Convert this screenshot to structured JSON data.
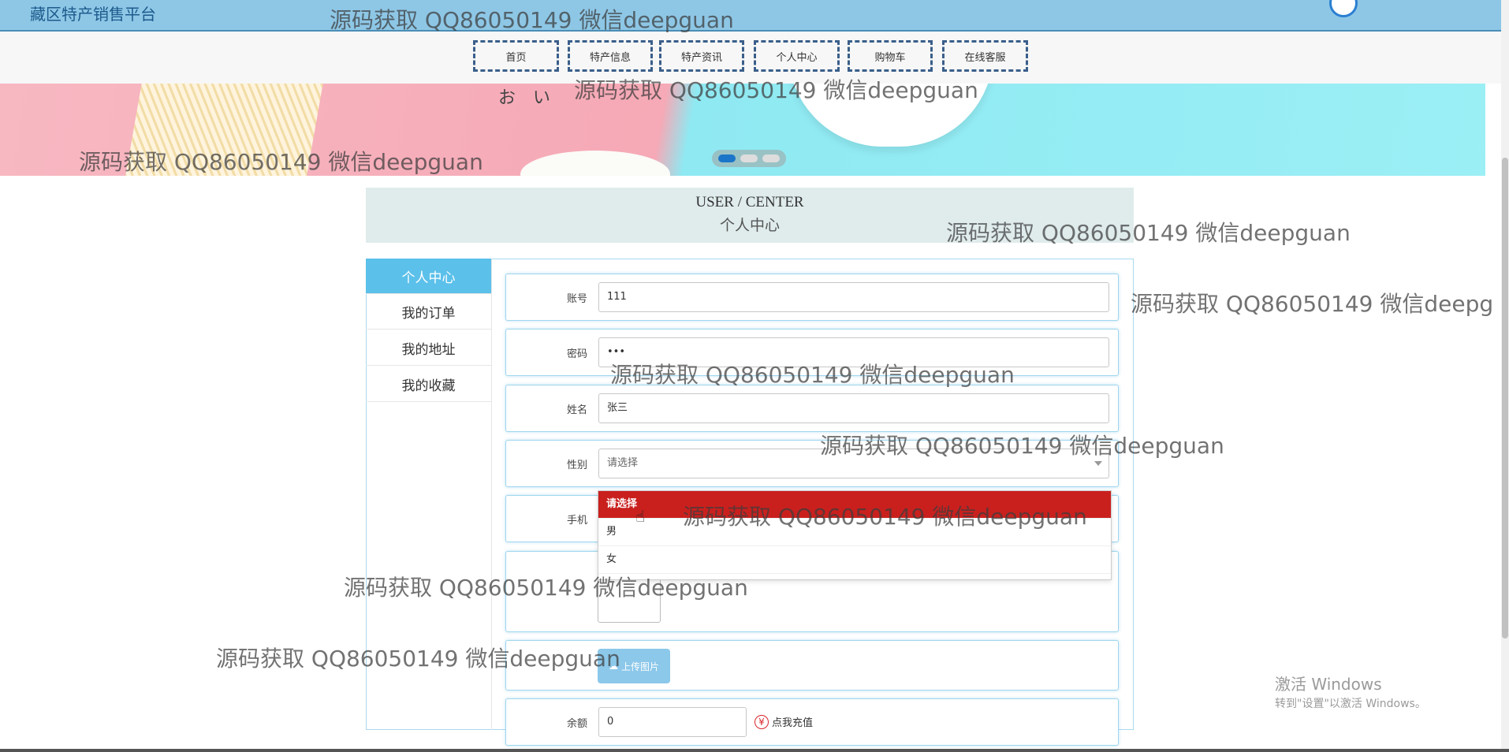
{
  "header": {
    "site_title": "藏区特产销售平台"
  },
  "nav": {
    "items": [
      "首页",
      "特产信息",
      "特产资讯",
      "个人中心",
      "购物车",
      "在线客服"
    ]
  },
  "banner": {
    "top_text": "お　い",
    "slides": 3,
    "active_slide": 1
  },
  "section": {
    "title_en": "USER / CENTER",
    "title_zh": "个人中心"
  },
  "sidebar": {
    "items": [
      "个人中心",
      "我的订单",
      "我的地址",
      "我的收藏"
    ],
    "active": "个人中心"
  },
  "form": {
    "account": {
      "label": "账号",
      "value": "111"
    },
    "password": {
      "label": "密码",
      "value": "•••"
    },
    "name": {
      "label": "姓名",
      "value": "张三"
    },
    "gender": {
      "label": "性别",
      "value": "请选择",
      "options": [
        "请选择",
        "男",
        "女"
      ],
      "highlighted": "请选择"
    },
    "phone": {
      "label": "手机",
      "value": ""
    },
    "upload_label": "上传图片",
    "balance": {
      "label": "余额",
      "value": "0"
    },
    "recharge_label": "点我充值",
    "recharge_icon": "¥"
  },
  "watermark": "源码获取 QQ86050149 微信deepguan",
  "watermark_cut": "源码获取 QQ86050149 微信deepg",
  "windows": {
    "line1": "激活 Windows",
    "line2": "转到\"设置\"以激活 Windows。"
  },
  "colors": {
    "accent": "#5bc0ea",
    "topbar": "#8ec7e6",
    "dropdown_active": "#c9201e",
    "recharge": "#d9262a"
  }
}
